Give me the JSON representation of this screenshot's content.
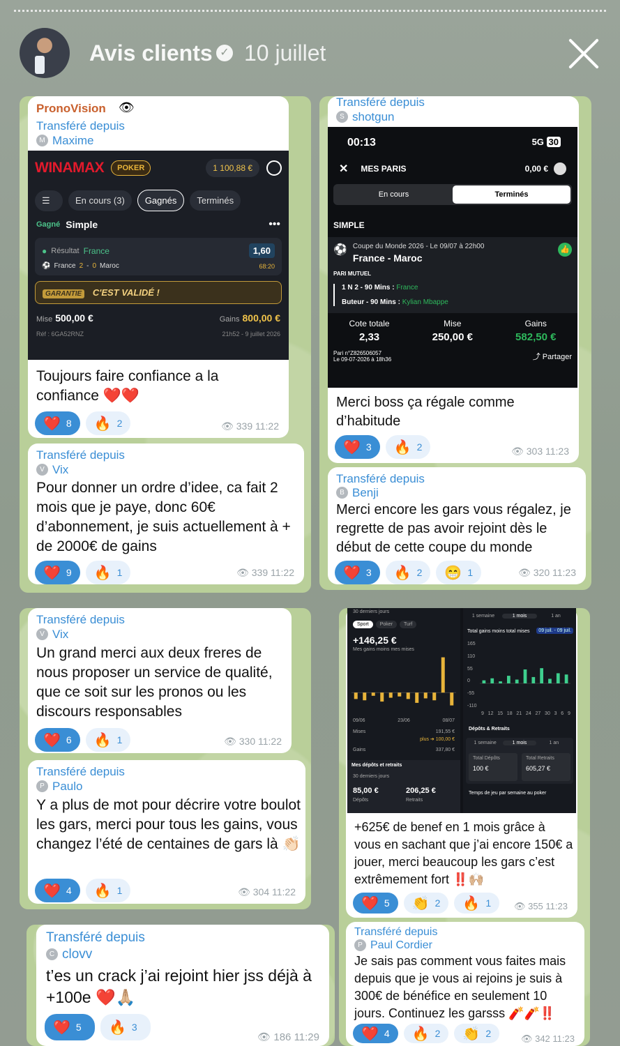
{
  "header": {
    "title": "Avis clients",
    "date": "10 juillet"
  },
  "fwd_label": "Transféré depuis",
  "cards": {
    "c1": {
      "channel": "PronoVision",
      "from": "Maxime",
      "from_initial": "M",
      "message": "Toujours faire confiance a la confiance ❤️❤️",
      "reactions": [
        {
          "emoji": "❤️",
          "count": "8"
        },
        {
          "emoji": "🔥",
          "count": "2"
        }
      ],
      "views": "339",
      "time": "11:22",
      "screenshot": {
        "brand": "WINAMAX",
        "poker": "POKER",
        "balance": "1 100,88 €",
        "tabs": [
          "En cours (3)",
          "Gagnés",
          "Terminés"
        ],
        "status": "Gagné",
        "type": "Simple",
        "result_label": "Résultat",
        "result_team": "France",
        "odds": "1,60",
        "match": "France",
        "score_home": "2",
        "score_away": "0",
        "opponent": "Maroc",
        "minute": "68:20",
        "guarantee": "GARANTIE",
        "validated": "C'EST VALIDÉ !",
        "stake_label": "Mise",
        "stake": "500,00 €",
        "gain_label": "Gains",
        "gain": "800,00 €",
        "ref": "Réf : 6GA52RNZ",
        "datetime": "21h52 - 9 juillet 2026"
      }
    },
    "c2": {
      "from": "Vix",
      "from_initial": "V",
      "message": "Pour donner un ordre d’idee, ca fait 2 mois que je paye, donc 60€ d’abonnement, je suis actuellement à + de 2000€ de gains",
      "reactions": [
        {
          "emoji": "❤️",
          "count": "9"
        },
        {
          "emoji": "🔥",
          "count": "1"
        }
      ],
      "views": "339",
      "time": "11:22"
    },
    "c3": {
      "from": "shotgun",
      "from_initial": "S",
      "message": "Merci boss ça régale comme d’habitude",
      "reactions": [
        {
          "emoji": "❤️",
          "count": "3"
        },
        {
          "emoji": "🔥",
          "count": "2"
        }
      ],
      "views": "303",
      "time": "11:23",
      "screenshot": {
        "clock": "00:13",
        "network": "5G",
        "battery": "30",
        "title": "MES PARIS",
        "balance": "0,00 €",
        "seg": [
          "En cours",
          "Terminés"
        ],
        "section": "SIMPLE",
        "competition": "Coupe du Monde 2026 - Le 09/07 à 22h00",
        "match": "France - Maroc",
        "brand": "PARI MUTUEL",
        "bet1": "1 N 2 - 90 Mins :",
        "bet1_val": "France",
        "bet2": "Buteur - 90 Mins :",
        "bet2_val": "Kylian Mbappe",
        "cote_label": "Cote totale",
        "cote": "2,33",
        "mise_label": "Mise",
        "mise": "250,00 €",
        "gains_label": "Gains",
        "gains": "582,50 €",
        "pari": "Pari n°Z826506057",
        "pari_date": "Le 09-07-2026 à 18h36",
        "share": "Partager"
      }
    },
    "c4": {
      "from": "Benji",
      "from_initial": "B",
      "message": "Merci encore les gars vous régalez, je regrette de pas avoir rejoint dès le début de cette coupe du monde",
      "reactions": [
        {
          "emoji": "❤️",
          "count": "3"
        },
        {
          "emoji": "🔥",
          "count": "2"
        },
        {
          "emoji": "😁",
          "count": "1"
        }
      ],
      "views": "320",
      "time": "11:23"
    },
    "c5": {
      "from": "Vix",
      "from_initial": "V",
      "message": "Un grand merci aux deux freres de nous proposer un service de qualité, que ce soit sur les pronos ou les discours responsables",
      "reactions": [
        {
          "emoji": "❤️",
          "count": "6"
        },
        {
          "emoji": "🔥",
          "count": "1"
        }
      ],
      "views": "330",
      "time": "11:22"
    },
    "c6": {
      "from": "Paulo",
      "from_initial": "P",
      "message": "Y a plus de mot pour décrire votre boulot les gars, merci pour tous les gains, vous changez l’été de centaines de gars là 👏🏻",
      "reactions": [
        {
          "emoji": "❤️",
          "count": "4"
        },
        {
          "emoji": "🔥",
          "count": "1"
        }
      ],
      "views": "304",
      "time": "11:22"
    },
    "c7": {
      "from": "clovv",
      "from_initial": "C",
      "message": "t’es un crack j’ai rejoint hier jss déjà à +100e ❤️🙏🏼",
      "reactions": [
        {
          "emoji": "❤️",
          "count": "5"
        },
        {
          "emoji": "🔥",
          "count": "3"
        }
      ],
      "views": "186",
      "time": "11:29"
    },
    "c8": {
      "message": "+625€ de benef en 1 mois grâce à vous en sachant que j’ai encore 150€ a jouer, merci beaucoup les gars c’est extrêmement fort ‼️🙌🏼",
      "reactions": [
        {
          "emoji": "❤️",
          "count": "5"
        },
        {
          "emoji": "👏",
          "count": "2"
        },
        {
          "emoji": "🔥",
          "count": "1"
        }
      ],
      "views": "355",
      "time": "11:23",
      "screenshot": {
        "left": {
          "period": "30 derniers jours",
          "pills": [
            "Sport",
            "Poker",
            "Turf"
          ],
          "total": "+146,25 €",
          "subtitle": "Mes gains moins mes mises",
          "dates": [
            "09/06",
            "23/06",
            "08/07"
          ],
          "mises_label": "Mises",
          "mises": "191,55 €",
          "plus_label": "plus ➔ 100,00 €",
          "gains_label": "Gains",
          "gains": "337,80 €",
          "dr_title": "Mes dépôts et retraits",
          "dr_period": "30 derniers jours",
          "depots": "85,00 €",
          "depots_label": "Dépôts",
          "retraits": "206,25 €",
          "retraits_label": "Retraits"
        },
        "right": {
          "tabs": [
            "1 semaine",
            "1 mois",
            "1 an"
          ],
          "chart_title": "Total gains moins total mises",
          "range": "09 juil. - 09 juil.",
          "yticks": [
            "165",
            "110",
            "55",
            "0",
            "-55",
            "-110"
          ],
          "xticks": [
            "9",
            "12",
            "15",
            "18",
            "21",
            "24",
            "27",
            "30",
            "3",
            "6",
            "9"
          ],
          "dr_title": "Dépôts & Retraits",
          "tot_dep_label": "Total Dépôts",
          "tot_dep": "100 €",
          "tot_ret_label": "Total Retraits",
          "tot_ret": "605,27 €",
          "footer": "Temps de jeu par semaine au poker"
        }
      }
    },
    "c9": {
      "from": "Paul Cordier",
      "from_initial": "P",
      "message": "Je sais pas comment vous faites mais depuis que je vous ai rejoins je suis à 300€ de bénéfice en seulement 10 jours. Continuez les garsss 🧨🧨‼️",
      "reactions": [
        {
          "emoji": "❤️",
          "count": "4"
        },
        {
          "emoji": "🔥",
          "count": "2"
        },
        {
          "emoji": "👏",
          "count": "2"
        }
      ],
      "views": "342",
      "time": "11:23"
    }
  },
  "chart_data": [
    {
      "type": "bar",
      "title": "",
      "values": [
        -10,
        -12,
        -5,
        -14,
        -8,
        -6,
        -10,
        -16,
        -9,
        -12,
        55,
        -20
      ],
      "x": [],
      "ylim": [
        -40,
        60
      ],
      "grid": false
    },
    {
      "type": "bar",
      "title": "Total gains moins total mises",
      "xlabel": "",
      "ylabel": "",
      "categories": [
        "9",
        "12",
        "15",
        "18",
        "21",
        "24",
        "27",
        "30",
        "3",
        "6",
        "9"
      ],
      "values": [
        12,
        20,
        8,
        30,
        15,
        55,
        25,
        60,
        18,
        40,
        35
      ],
      "ylim": [
        -110,
        165
      ],
      "grid": true
    }
  ]
}
